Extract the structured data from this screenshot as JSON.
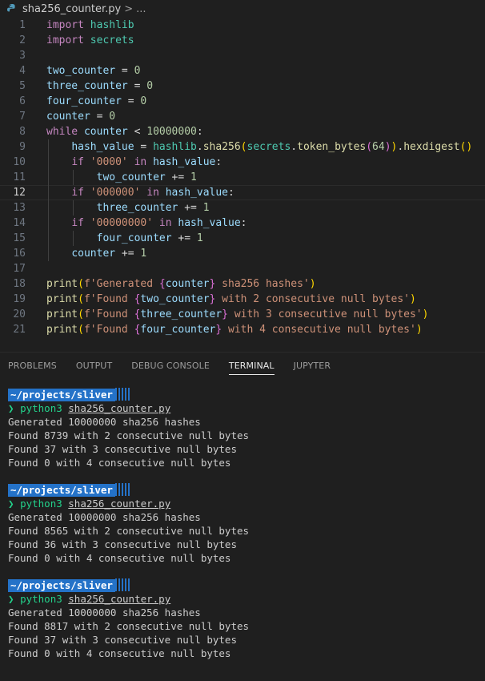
{
  "breadcrumb": {
    "file": "sha256_counter.py",
    "separator": ">",
    "more": "..."
  },
  "editor": {
    "lines": [
      {
        "n": "1"
      },
      {
        "n": "2"
      },
      {
        "n": "3"
      },
      {
        "n": "4"
      },
      {
        "n": "5"
      },
      {
        "n": "6"
      },
      {
        "n": "7"
      },
      {
        "n": "8"
      },
      {
        "n": "9"
      },
      {
        "n": "10"
      },
      {
        "n": "11"
      },
      {
        "n": "12"
      },
      {
        "n": "13"
      },
      {
        "n": "14"
      },
      {
        "n": "15"
      },
      {
        "n": "16"
      },
      {
        "n": "17"
      },
      {
        "n": "18"
      },
      {
        "n": "19"
      },
      {
        "n": "20"
      },
      {
        "n": "21"
      }
    ],
    "code": {
      "l1_kw": "import",
      "l1_mod": "hashlib",
      "l2_kw": "import",
      "l2_mod": "secrets",
      "l4": "two_counter",
      "l4_op": " = ",
      "l4_num": "0",
      "l5": "three_counter",
      "l5_op": " = ",
      "l5_num": "0",
      "l6": "four_counter",
      "l6_op": " = ",
      "l6_num": "0",
      "l7": "counter",
      "l7_op": " = ",
      "l7_num": "0",
      "l8_kw": "while",
      "l8_var": "counter",
      "l8_op": " < ",
      "l8_num": "10000000",
      "l8_colon": ":",
      "l9_var": "hash_value",
      "l9_op": " = ",
      "l9_mod": "hashlib",
      "l9_dot": ".",
      "l9_fn": "sha256",
      "l9_p1": "(",
      "l9_mod2": "secrets",
      "l9_dot2": ".",
      "l9_fn2": "token_bytes",
      "l9_p2": "(",
      "l9_num": "64",
      "l9_p3": ")",
      "l9_p4": ")",
      "l9_dot3": ".",
      "l9_fn3": "hexdigest",
      "l9_p5": "()",
      "l10_kw": "if",
      "l10_str": "'0000'",
      "l10_in": "in",
      "l10_var": "hash_value",
      "l10_colon": ":",
      "l11_var": "two_counter",
      "l11_op": " += ",
      "l11_num": "1",
      "l12_kw": "if",
      "l12_str": "'000000'",
      "l12_in": "in",
      "l12_var": "hash_value",
      "l12_colon": ":",
      "l13_var": "three_counter",
      "l13_op": " += ",
      "l13_num": "1",
      "l14_kw": "if",
      "l14_str": "'00000000'",
      "l14_in": "in",
      "l14_var": "hash_value",
      "l14_colon": ":",
      "l15_var": "four_counter",
      "l15_op": " += ",
      "l15_num": "1",
      "l16_var": "counter",
      "l16_op": " += ",
      "l16_num": "1",
      "l18_fn": "print",
      "l18_p1": "(",
      "l18_s1": "f'Generated ",
      "l18_b1": "{",
      "l18_v": "counter",
      "l18_b2": "}",
      "l18_s2": " sha256 hashes'",
      "l18_p2": ")",
      "l19_fn": "print",
      "l19_p1": "(",
      "l19_s1": "f'Found ",
      "l19_b1": "{",
      "l19_v": "two_counter",
      "l19_b2": "}",
      "l19_s2": " with 2 consecutive null bytes'",
      "l19_p2": ")",
      "l20_fn": "print",
      "l20_p1": "(",
      "l20_s1": "f'Found ",
      "l20_b1": "{",
      "l20_v": "three_counter",
      "l20_b2": "}",
      "l20_s2": " with 3 consecutive null bytes'",
      "l20_p2": ")",
      "l21_fn": "print",
      "l21_p1": "(",
      "l21_s1": "f'Found ",
      "l21_b1": "{",
      "l21_v": "four_counter",
      "l21_b2": "}",
      "l21_s2": " with 4 consecutive null bytes'",
      "l21_p2": ")"
    }
  },
  "panel": {
    "tabs": [
      "PROBLEMS",
      "OUTPUT",
      "DEBUG CONSOLE",
      "TERMINAL",
      "JUPYTER"
    ],
    "active_tab": "TERMINAL"
  },
  "terminal": {
    "prompt_path": "~/projects/sliver",
    "prompt_arrow": "❯",
    "command": "python3",
    "argument": "sha256_counter.py",
    "runs": [
      {
        "generated": "Generated 10000000 sha256 hashes",
        "two": "Found 8739 with 2 consecutive null bytes",
        "three": "Found 37 with 3 consecutive null bytes",
        "four": "Found 0 with 4 consecutive null bytes"
      },
      {
        "generated": "Generated 10000000 sha256 hashes",
        "two": "Found 8565 with 2 consecutive null bytes",
        "three": "Found 36 with 3 consecutive null bytes",
        "four": "Found 0 with 4 consecutive null bytes"
      },
      {
        "generated": "Generated 10000000 sha256 hashes",
        "two": "Found 8817 with 2 consecutive null bytes",
        "three": "Found 37 with 3 consecutive null bytes",
        "four": "Found 0 with 4 consecutive null bytes"
      }
    ]
  },
  "colors": {
    "accent": "#2472c8",
    "prompt_green": "#23d18b",
    "background": "#1f1f1f"
  }
}
